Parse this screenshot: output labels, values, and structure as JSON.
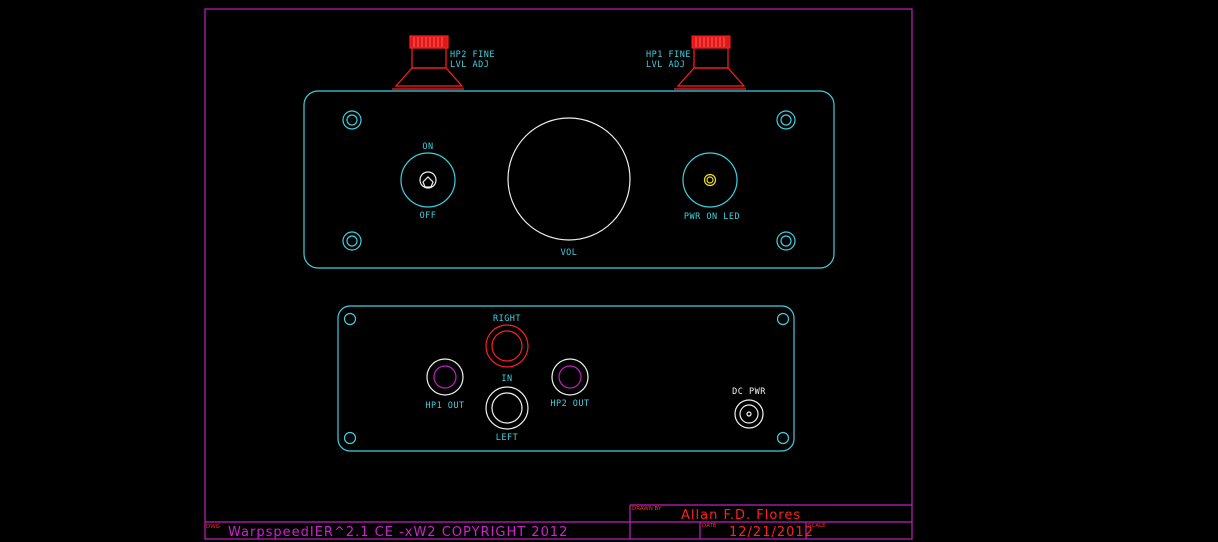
{
  "knobs": {
    "hp2_fine": [
      "HP2 FINE",
      "LVL ADJ"
    ],
    "hp1_fine": [
      "HP1 FINE",
      "LVL ADJ"
    ]
  },
  "front_panel": {
    "switch_on": "ON",
    "switch_off": "OFF",
    "volume": "VOL",
    "led": "PWR ON LED"
  },
  "rear_panel": {
    "right": "RIGHT",
    "in": "IN",
    "left": "LEFT",
    "hp1_out": "HP1 OUT",
    "hp2_out": "HP2 OUT",
    "dc_pwr": "DC PWR"
  },
  "title_block": {
    "dwg_label": "DWG",
    "drawing_title": "WarpspeedIER^2.1 CE -xW2  COPYRIGHT 2012",
    "drawn_by_label": "DRAWN BY",
    "drawn_by": "Allan F.D. Flores",
    "date_label": "DATE",
    "date": "12/21/2012",
    "scale_label": "SCALE"
  },
  "colors": {
    "outline": "#3fd0e0",
    "frame": "#c020c0",
    "knob": "#ff2020",
    "jack": "#f0f0f0",
    "led": "#f0e020",
    "background": "#000000"
  }
}
